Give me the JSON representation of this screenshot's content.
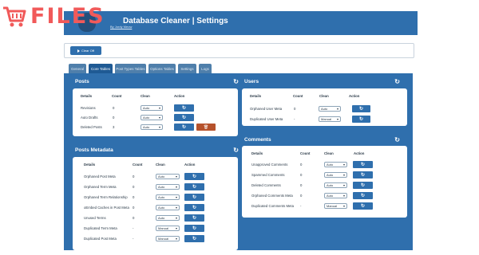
{
  "watermark": {
    "text": "FILES",
    "icon": "shopping-cart-icon",
    "color": "#f15a5a"
  },
  "header": {
    "title": "Database Cleaner | Settings",
    "byline": "By Jordy Meow"
  },
  "actions": {
    "clear_log": "Clear Off"
  },
  "tabs": [
    "General",
    "Core Tables",
    "Post Types Tables",
    "Options Tables",
    "Settings",
    "Logs"
  ],
  "active_tab": "Core Tables",
  "columns": {
    "details": "Details",
    "count": "Count",
    "clean": "Clean",
    "action": "Action"
  },
  "posts": {
    "title": "Posts",
    "rows": [
      {
        "label": "Revisions",
        "count": "0",
        "clean": "Auto",
        "delete": false
      },
      {
        "label": "Auto Drafts",
        "count": "0",
        "clean": "Auto",
        "delete": false
      },
      {
        "label": "Deleted Posts",
        "count": "3",
        "clean": "Auto",
        "delete": true
      }
    ]
  },
  "posts_metadata": {
    "title": "Posts Metadata",
    "rows": [
      {
        "label": "Orphaned Post Meta",
        "count": "0",
        "clean": "Auto"
      },
      {
        "label": "Orphaned Term Meta",
        "count": "0",
        "clean": "Auto"
      },
      {
        "label": "Orphaned Term Relationship",
        "count": "0",
        "clean": "Auto"
      },
      {
        "label": "oEmbed Caches in Post Meta",
        "count": "0",
        "clean": "Auto"
      },
      {
        "label": "Unused Terms",
        "count": "0",
        "clean": "Auto"
      },
      {
        "label": "Duplicated Term Meta",
        "count": "-",
        "clean": "Manual"
      },
      {
        "label": "Duplicated Post Meta",
        "count": "-",
        "clean": "Manual"
      }
    ]
  },
  "users": {
    "title": "Users",
    "rows": [
      {
        "label": "Orphaned User Meta",
        "count": "0",
        "clean": "Auto"
      },
      {
        "label": "Duplicated User Meta",
        "count": "-",
        "clean": "Manual"
      }
    ]
  },
  "comments": {
    "title": "Comments",
    "rows": [
      {
        "label": "Unapproved Comments",
        "count": "0",
        "clean": "Auto"
      },
      {
        "label": "Spammed Comments",
        "count": "0",
        "clean": "Auto"
      },
      {
        "label": "Deleted Comments",
        "count": "0",
        "clean": "Auto"
      },
      {
        "label": "Orphaned Comments Meta",
        "count": "0",
        "clean": "Auto"
      },
      {
        "label": "Duplicated Comments Meta",
        "count": "-",
        "clean": "Manual"
      }
    ]
  },
  "icons": {
    "refresh": "refresh-icon",
    "trash": "trash-icon",
    "chevron": "chevron-down-icon"
  }
}
